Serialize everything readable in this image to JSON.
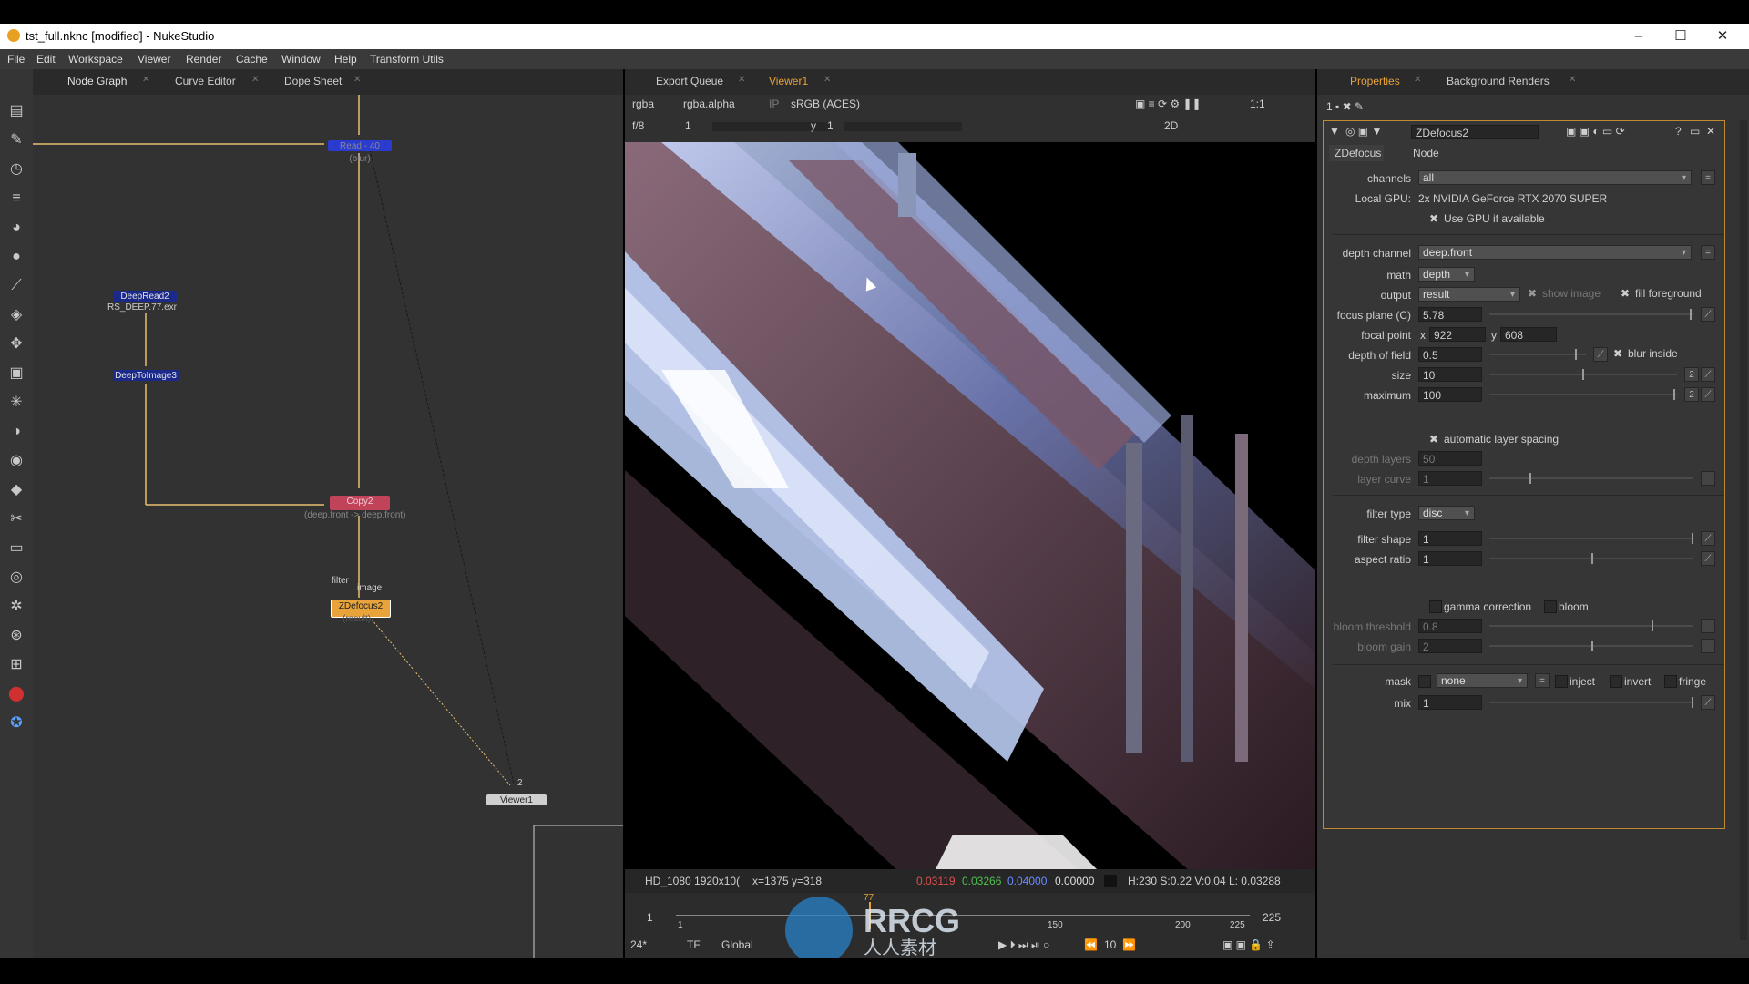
{
  "window": {
    "title": "tst_full.nknc [modified] - NukeStudio",
    "min_glyph": "–",
    "max_glyph": "☐",
    "close_glyph": "✕"
  },
  "menu": [
    "File",
    "Edit",
    "Workspace",
    "Viewer",
    "Render",
    "Cache",
    "Window",
    "Help",
    "Transform Utils"
  ],
  "left_panel": {
    "tabs": [
      "Node Graph",
      "Curve Editor",
      "Dope Sheet"
    ]
  },
  "nodes": {
    "top_node": "Read - 40 (blur)",
    "deepread": "DeepRead2",
    "deepread_file": "RS_DEEP.77.exr",
    "deeptoimage": "DeepToImage3",
    "copy": "Copy2",
    "copy_sub": "(deep.front -> deep.front)",
    "zdefocus": "ZDefocus2",
    "zdefocus_sub": "(result)",
    "viewer": "Viewer1",
    "input_filter": "filter",
    "input_image": "image",
    "viewer_input": "2"
  },
  "viewer": {
    "tabs": [
      "Export Queue",
      "Viewer1"
    ],
    "channels": "rgba",
    "alpha": "rgba.alpha",
    "ip": "IP",
    "colorspace": "sRGB (ACES)",
    "zoom": "1:1",
    "fstop": "f/8",
    "frame_field": "1",
    "y_label": "y",
    "y_value": "1",
    "view_mode": "2D",
    "info_format": "HD_1080 1920x10(",
    "info_coords": "x=1375 y=318",
    "info_r": "0.03119",
    "info_g": "0.03266",
    "info_b": "0.04000",
    "info_a": "0.00000",
    "info_hsv": "H:230 S:0.22 V:0.04  L: 0.03288",
    "timeline_start": "1",
    "timeline_end": "225",
    "timeline_ticks": [
      "1",
      "150",
      "200",
      "225"
    ],
    "current_frame": "77",
    "fps": "24*",
    "tf": "TF",
    "global": "Global",
    "step": "10"
  },
  "properties": {
    "tabs": [
      "Properties",
      "Background Renders"
    ],
    "node_name": "ZDefocus2",
    "subtabs": [
      "ZDefocus",
      "Node"
    ],
    "channels_label": "channels",
    "channels_value": "all",
    "gpu_label": "Local GPU:",
    "gpu_value": "2x NVIDIA GeForce RTX 2070 SUPER",
    "use_gpu": "Use GPU if available",
    "depth_channel_label": "depth channel",
    "depth_channel_value": "deep.front",
    "math_label": "math",
    "math_value": "depth",
    "output_label": "output",
    "output_value": "result",
    "show_image": "show image",
    "fill_foreground": "fill foreground",
    "focus_plane_label": "focus plane (C)",
    "focus_plane_value": "5.78",
    "focal_point_label": "focal point",
    "focal_x_label": "x",
    "focal_x": "922",
    "focal_y_label": "y",
    "focal_y": "608",
    "dof_label": "depth of field",
    "dof_value": "0.5",
    "blur_inside": "blur inside",
    "size_label": "size",
    "size_value": "10",
    "size_badge": "2",
    "maximum_label": "maximum",
    "maximum_value": "100",
    "maximum_badge": "2",
    "auto_layer": "automatic layer spacing",
    "depth_layers_label": "depth layers",
    "depth_layers_value": "50",
    "layer_curve_label": "layer curve",
    "layer_curve_value": "1",
    "filter_type_label": "filter type",
    "filter_type_value": "disc",
    "filter_shape_label": "filter shape",
    "filter_shape_value": "1",
    "aspect_ratio_label": "aspect ratio",
    "aspect_ratio_value": "1",
    "gamma_correction": "gamma correction",
    "bloom": "bloom",
    "bloom_threshold_label": "bloom threshold",
    "bloom_threshold_value": "0.8",
    "bloom_gain_label": "bloom gain",
    "bloom_gain_value": "2",
    "mask_label": "mask",
    "mask_value": "none",
    "inject": "inject",
    "invert": "invert",
    "fringe": "fringe",
    "mix_label": "mix",
    "mix_value": "1",
    "checkmark": "✖"
  },
  "watermark": {
    "text": "RRCG",
    "sub": "人人素材"
  },
  "colors": {
    "accent_orange": "#e8a33a",
    "node_blue": "#1b2a8a",
    "node_copy": "#c0435a",
    "node_zdefocus": "#e8a33a"
  }
}
